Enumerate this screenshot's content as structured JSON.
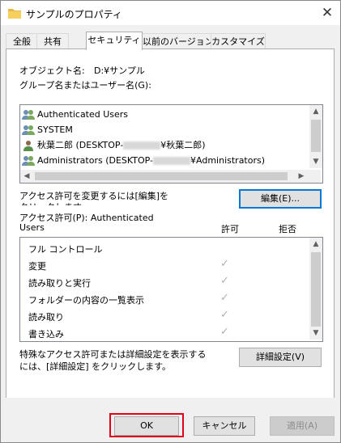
{
  "window": {
    "title": "サンプルのプロパティ",
    "close_glyph": "✕"
  },
  "tabs": [
    {
      "label": "全般"
    },
    {
      "label": "共有"
    },
    {
      "label": "セキュリティ"
    },
    {
      "label": "以前のバージョン"
    },
    {
      "label": "カスタマイズ"
    }
  ],
  "security": {
    "object_label": "オブジェクト名:",
    "object_value": "D:¥サンプル",
    "group_label": "グループ名またはユーザー名(G):",
    "users": [
      {
        "icon": "users-group-icon",
        "name": "Authenticated Users"
      },
      {
        "icon": "users-group-icon",
        "name": "SYSTEM"
      },
      {
        "icon": "user-icon",
        "name_prefix": "秋葉二郎 (DESKTOP-",
        "name_suffix": "¥秋葉二郎)"
      },
      {
        "icon": "users-group-icon",
        "name_prefix": "Administrators (DESKTOP-",
        "name_suffix": "¥Administrators)"
      }
    ],
    "change_text_line1": "アクセス許可を変更するには[編集]を",
    "change_text_line2": "クリックします。",
    "edit_button": "編集(E)...",
    "perm_for_line1": "アクセス許可(P): Authenticated",
    "perm_for_line2": "Users",
    "col_allow": "許可",
    "col_deny": "拒否",
    "permissions": [
      {
        "name": "フル コントロール",
        "allow": false,
        "deny": false
      },
      {
        "name": "変更",
        "allow": true,
        "deny": false
      },
      {
        "name": "読み取りと実行",
        "allow": true,
        "deny": false
      },
      {
        "name": "フォルダーの内容の一覧表示",
        "allow": true,
        "deny": false
      },
      {
        "name": "読み取り",
        "allow": true,
        "deny": false
      },
      {
        "name": "書き込み",
        "allow": true,
        "deny": false
      }
    ],
    "check_glyph": "✓",
    "advanced_text_line1": "特殊なアクセス許可または詳細設定を表示する",
    "advanced_text_line2": "には、[詳細設定] をクリックします。",
    "advanced_button": "詳細設定(V)"
  },
  "footer": {
    "ok": "OK",
    "cancel": "キャンセル",
    "apply": "適用(A)"
  },
  "colors": {
    "highlight_box": "#e0001a",
    "focus": "#0078d7"
  }
}
